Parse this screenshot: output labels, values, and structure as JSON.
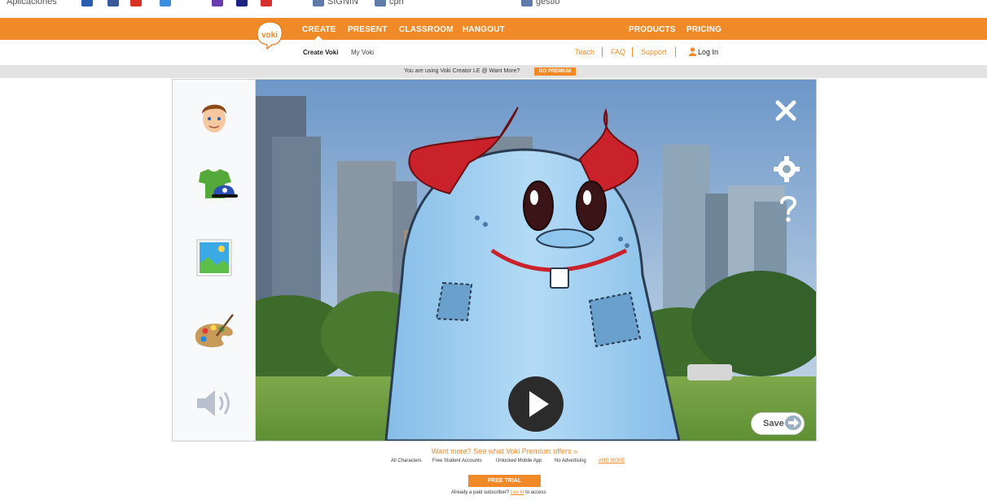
{
  "bookmarks": {
    "items": [
      "Aplicaciones",
      "SIGNIN",
      "cpri",
      "gestio"
    ]
  },
  "nav": {
    "logo_text": "voki",
    "main": [
      "CREATE",
      "PRESENT",
      "CLASSROOM",
      "HANGOUT"
    ],
    "products": "PRODUCTS",
    "pricing": "PRICING",
    "sub": {
      "create_voki": "Create Voki",
      "my_voki": "My Voki"
    },
    "right": {
      "teach": "Teach",
      "faq": "FAQ",
      "support": "Support",
      "login": "Log In"
    }
  },
  "banner": {
    "text": "You are using Voki Creator LE @ Want More?",
    "button": "GO PREMIUM"
  },
  "editor": {
    "tools": [
      "character-icon",
      "clothing-icon",
      "background-icon",
      "palette-icon",
      "speaker-icon"
    ],
    "save_label": "Save"
  },
  "footer": {
    "premium_link": "Want more? See what Voki Premium offers »",
    "features": [
      "All Characters",
      "Free Student Accounts",
      "Unlocked Mobile App",
      "No Advertising"
    ],
    "and_more": "AND MORE",
    "trial_button": "FREE TRIAL",
    "already_text": "Already a paid subscriber?",
    "login_link": "Log In",
    "access_text": "to access"
  },
  "colors": {
    "brand": "#f08a28",
    "character": "#a9d2f4",
    "horn": "#c9222a"
  }
}
